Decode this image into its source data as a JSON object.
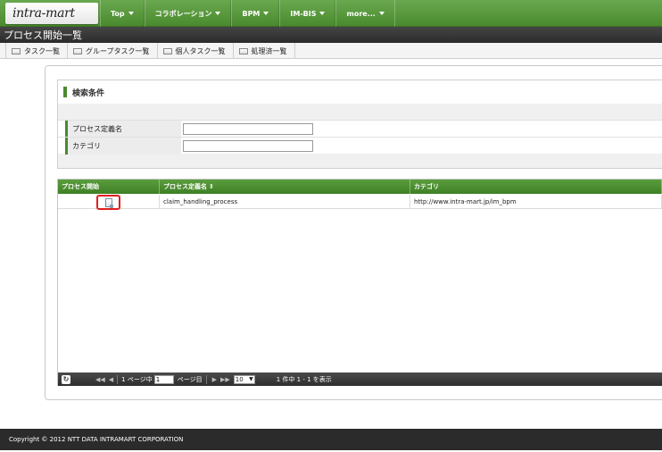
{
  "header": {
    "logo_text": "intra-mart",
    "nav": [
      {
        "label": "Top"
      },
      {
        "label": "コラボレーション"
      },
      {
        "label": "BPM"
      },
      {
        "label": "IM-BIS"
      },
      {
        "label": "more..."
      }
    ]
  },
  "page_title": "プロセス開始一覧",
  "tabs": [
    {
      "label": "タスク一覧"
    },
    {
      "label": "グループタスク一覧"
    },
    {
      "label": "個人タスク一覧"
    },
    {
      "label": "処理済一覧"
    }
  ],
  "search": {
    "title": "検索条件",
    "fields": [
      {
        "label": "プロセス定義名",
        "value": ""
      },
      {
        "label": "カテゴリ",
        "value": ""
      }
    ]
  },
  "grid": {
    "columns": [
      "プロセス開始",
      "プロセス定義名",
      "カテゴリ"
    ],
    "rows": [
      {
        "name": "claim_handling_process",
        "category": "http://www.intra-mart.jp/im_bpm"
      }
    ]
  },
  "pager": {
    "page_prefix": "1 ページ中",
    "page_value": "1",
    "page_suffix": "ページ目",
    "rows_per_page": "10",
    "info": "1 件中 1 - 1 を表示"
  },
  "footer": {
    "copyright": "Copyright © 2012 NTT DATA INTRAMART CORPORATION"
  }
}
